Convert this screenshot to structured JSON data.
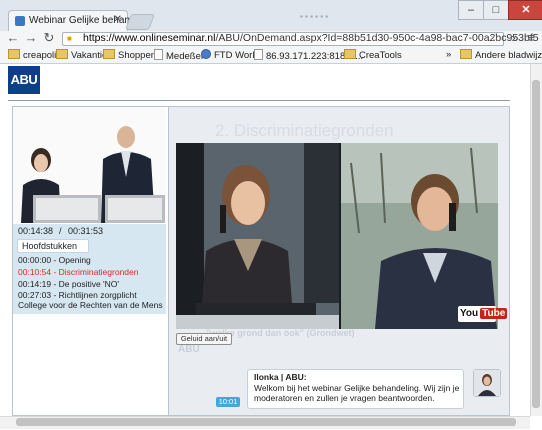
{
  "browser": {
    "tab_title": "Webinar Gelijke behandel",
    "url_host": "https://www.onlineseminar.nl",
    "url_path": "/ABU/OnDemand.aspx?Id=88b51d30-950c-4a98-bac7-00a2bc953bf5",
    "bookmarks": [
      "creapolis",
      "Vakantie",
      "Shoppen",
      "Medeßer",
      "FTD World",
      "86.93.171.223:8181/i...",
      "CreaTools"
    ],
    "more_bookmarks": "»",
    "other_bookmarks": "Andere bladwijzers"
  },
  "page": {
    "logo_text": "ABU",
    "clock": {
      "elapsed": "00:14:38",
      "separator": "/",
      "total": "00:31:53"
    },
    "chapters_heading": "Hoofdstukken",
    "chapters": [
      "00:00:00 - Opening",
      "00:10:54 - Discriminatiegronden",
      "00:14:19 - De positive 'NO'",
      "00:27:03 - Richtlijnen zorgplicht College voor de Rechten van de Mens"
    ],
    "slide_title": "2. Discriminatiegronden",
    "caption_toggle": "Geluid aan/uit",
    "caption_text": "\"welke grond dan ook\" (Grondwet)",
    "video_logo": "ABU",
    "youtube": {
      "you": "You",
      "tube": "Tube"
    },
    "chat": {
      "time": "10:01",
      "author": "Ilonka | ABU:",
      "message": "Welkom bij het webinar Gelijke behandeling. Wij zijn je moderatoren en zullen je vragen beantwoorden."
    }
  },
  "colors": {
    "brand_blue": "#0c3f87",
    "active_chapter": "#d1301b",
    "chat_time_badge": "#46a6dc"
  }
}
